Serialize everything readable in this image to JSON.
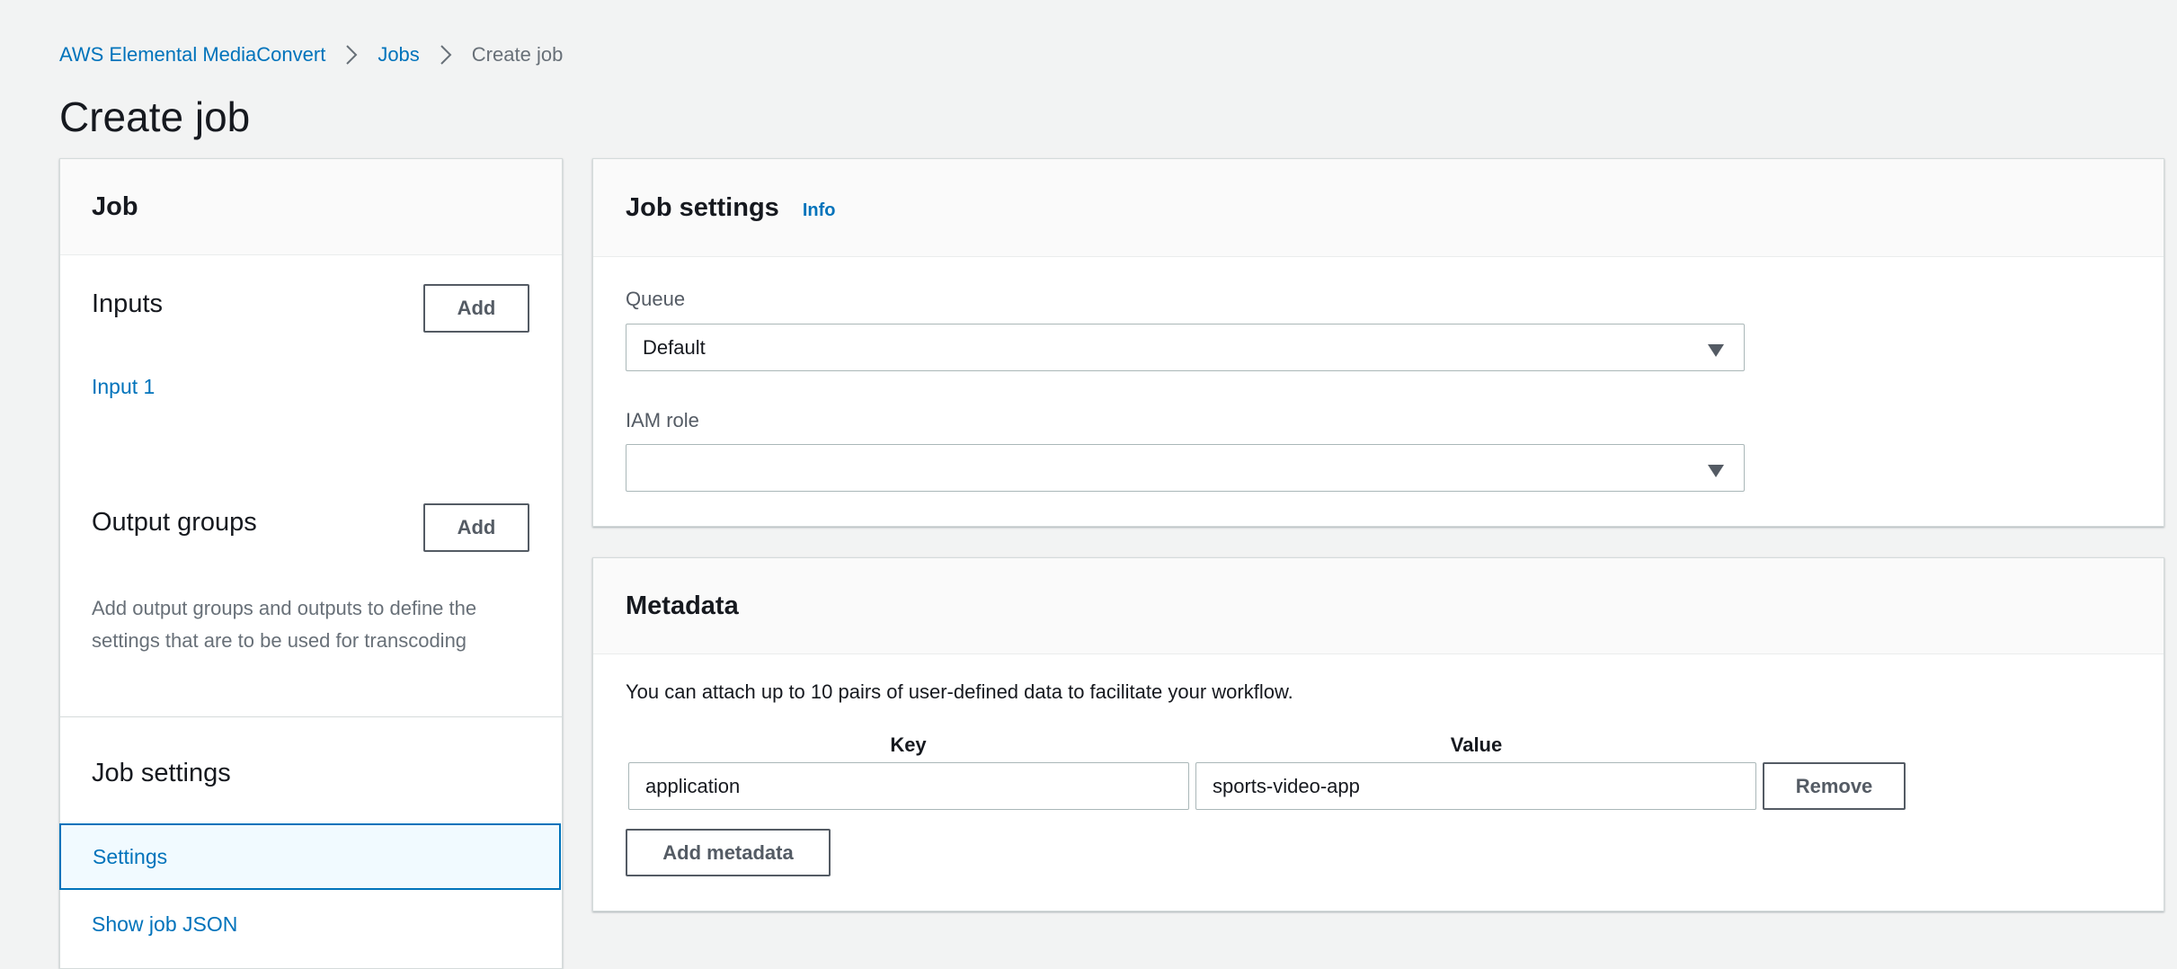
{
  "breadcrumb": {
    "service": "AWS Elemental MediaConvert",
    "jobs": "Jobs",
    "current": "Create job"
  },
  "page": {
    "title": "Create job"
  },
  "left_nav": {
    "header": "Job",
    "inputs": {
      "title": "Inputs",
      "add_label": "Add",
      "items": [
        "Input 1"
      ]
    },
    "output_groups": {
      "title": "Output groups",
      "add_label": "Add",
      "help": "Add output groups and outputs to define the settings that are to be used for transcoding"
    },
    "job_settings": {
      "title": "Job settings",
      "settings_label": "Settings",
      "show_json_label": "Show job JSON"
    }
  },
  "job_settings_panel": {
    "title": "Job settings",
    "info_label": "Info",
    "queue": {
      "label": "Queue",
      "value": "Default"
    },
    "iam_role": {
      "label": "IAM role",
      "value": ""
    }
  },
  "metadata_panel": {
    "title": "Metadata",
    "description": "You can attach up to 10 pairs of user-defined data to facilitate your workflow.",
    "key_header": "Key",
    "value_header": "Value",
    "rows": [
      {
        "key": "application",
        "value": "sports-video-app"
      }
    ],
    "remove_label": "Remove",
    "add_label": "Add metadata"
  },
  "colors": {
    "link": "#0073bb",
    "background": "#f2f3f3",
    "panel_header": "#fafafa",
    "selected_bg": "#f1faff",
    "secondary_text": "#687078"
  },
  "icons": {
    "breadcrumb_separator": "chevron-right-icon",
    "select_caret": "caret-down-icon"
  }
}
